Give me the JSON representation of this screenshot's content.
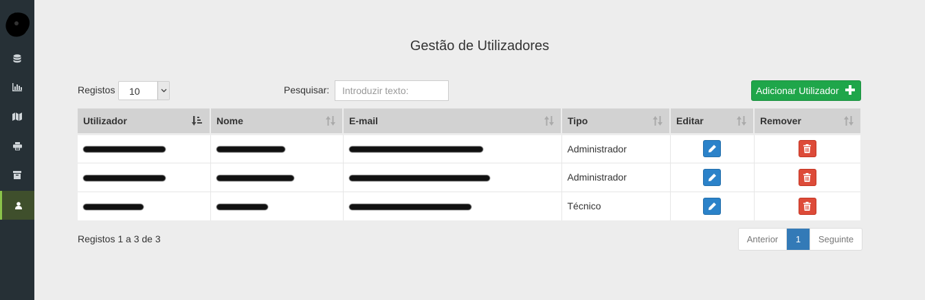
{
  "sidebar": {
    "items": [
      {
        "icon": "database-icon"
      },
      {
        "icon": "bar-chart-icon"
      },
      {
        "icon": "map-icon"
      },
      {
        "icon": "print-icon"
      },
      {
        "icon": "archive-icon"
      },
      {
        "icon": "user-icon",
        "active": true
      }
    ]
  },
  "page": {
    "title": "Gestão de Utilizadores"
  },
  "controls": {
    "length_label": "Registos",
    "length_value": "10",
    "search_label": "Pesquisar:",
    "search_placeholder": "Introduzir texto:",
    "add_button": "Adicionar Utilizador"
  },
  "table": {
    "headers": [
      "Utilizador",
      "Nome",
      "E-mail",
      "Tipo",
      "Editar",
      "Remover"
    ],
    "rows": [
      {
        "tipo": "Administrador"
      },
      {
        "tipo": "Administrador"
      },
      {
        "tipo": "Técnico"
      }
    ]
  },
  "footer": {
    "info": "Registos 1 a 3 de 3",
    "prev": "Anterior",
    "page": "1",
    "next": "Seguinte"
  },
  "colors": {
    "sidebar": "#263036",
    "add_button": "#1fa64a",
    "edit_button": "#2b82c9",
    "delete_button": "#dd4b39",
    "pager_active": "#337ab7"
  }
}
